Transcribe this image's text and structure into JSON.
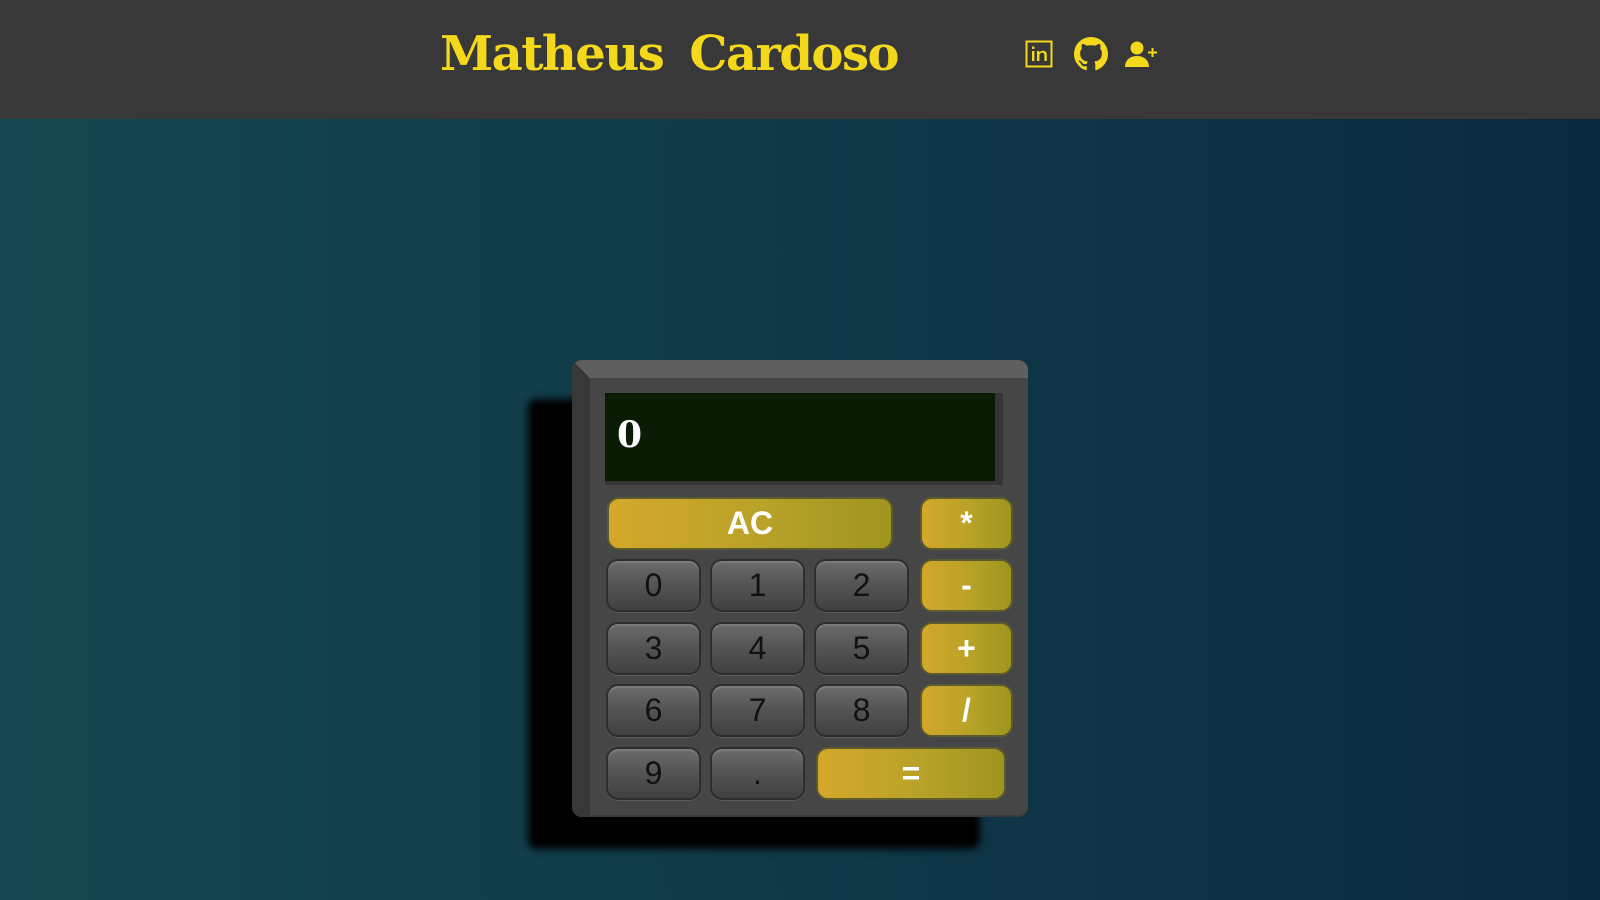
{
  "header": {
    "name_first": "Matheus",
    "name_last": "Cardoso",
    "links": [
      {
        "icon": "linkedin-icon"
      },
      {
        "icon": "github-icon"
      },
      {
        "icon": "add-user-icon"
      }
    ]
  },
  "calculator": {
    "display": "0",
    "keys": {
      "ac": "AC",
      "multiply": "*",
      "subtract": "-",
      "add": "+",
      "divide": "/",
      "equals": "=",
      "decimal": ".",
      "digits": [
        "0",
        "1",
        "2",
        "3",
        "4",
        "5",
        "6",
        "7",
        "8",
        "9"
      ]
    }
  },
  "colors": {
    "accent": "#f3d81c",
    "header_bg": "#383838",
    "key_gold": "#c9a82a",
    "display_bg": "#0a1c04"
  }
}
